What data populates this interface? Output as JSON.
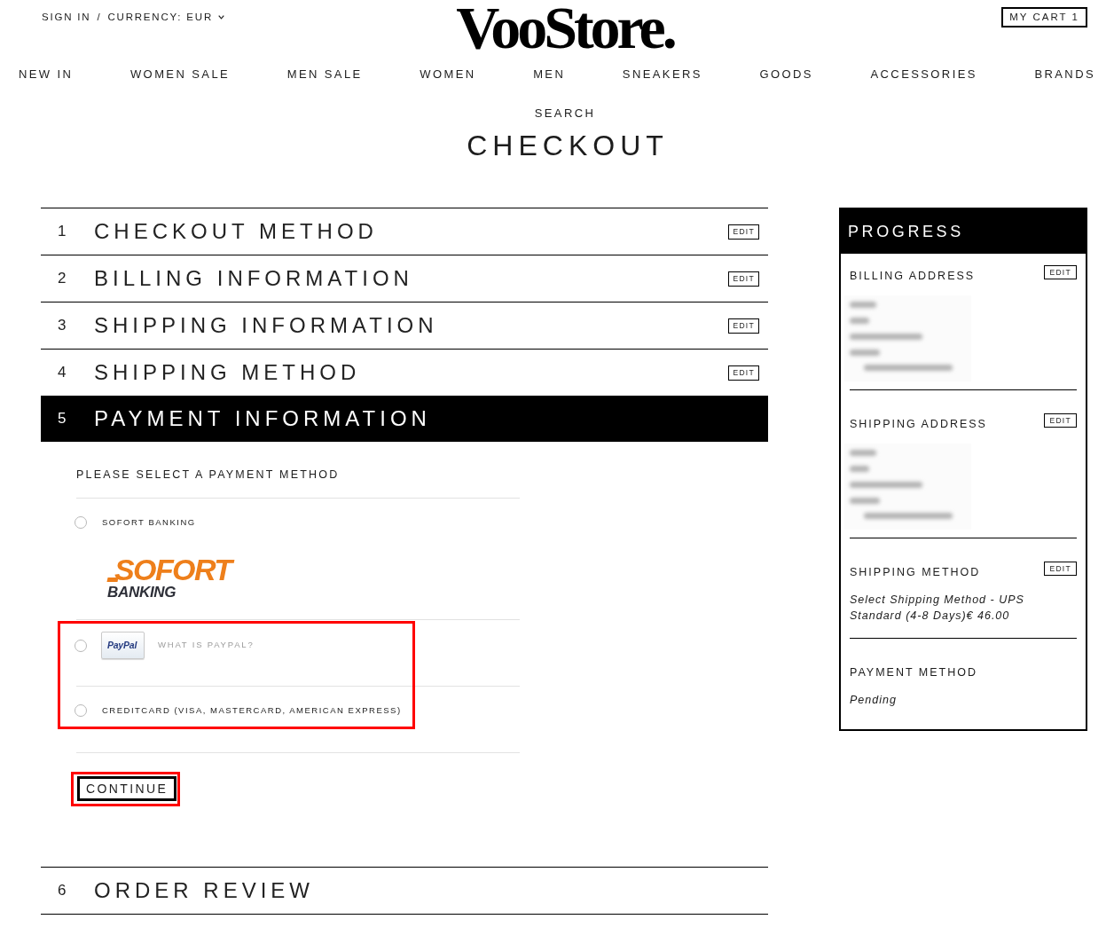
{
  "header": {
    "sign_in": "SIGN IN",
    "separator": "/",
    "currency": "CURRENCY: EUR",
    "logo": "VooStore.",
    "cart": "MY CART 1"
  },
  "nav": [
    "NEW IN",
    "WOMEN SALE",
    "MEN SALE",
    "WOMEN",
    "MEN",
    "SNEAKERS",
    "GOODS",
    "ACCESSORIES",
    "BRANDS"
  ],
  "search": "SEARCH",
  "page_title": "CHECKOUT",
  "steps": [
    {
      "number": "1",
      "title": "CHECKOUT METHOD",
      "edit": "EDIT",
      "active": false
    },
    {
      "number": "2",
      "title": "BILLING INFORMATION",
      "edit": "EDIT",
      "active": false
    },
    {
      "number": "3",
      "title": "SHIPPING INFORMATION",
      "edit": "EDIT",
      "active": false
    },
    {
      "number": "4",
      "title": "SHIPPING METHOD",
      "edit": "EDIT",
      "active": false
    },
    {
      "number": "5",
      "title": "PAYMENT INFORMATION",
      "active": true,
      "panel": {
        "prompt": "PLEASE SELECT A PAYMENT METHOD",
        "options": [
          {
            "kind": "sofort",
            "label": "SOFORT BANKING",
            "logo": [
              "SOFORT",
              "BANKING"
            ],
            "selected": false,
            "highlighted": false
          },
          {
            "kind": "paypal",
            "logo": "PayPal",
            "link": "WHAT IS PAYPAL?",
            "selected": false,
            "highlighted": true
          },
          {
            "kind": "plain",
            "label": "CREDITCARD (VISA, MASTERCARD, AMERICAN EXPRESS)",
            "selected": false,
            "highlighted": true
          }
        ],
        "continue": {
          "label": "CONTINUE",
          "highlighted": true
        }
      }
    },
    {
      "number": "6",
      "title": "ORDER REVIEW",
      "active": false
    }
  ],
  "progress": {
    "title": "PROGRESS",
    "sections": [
      {
        "kind": "address",
        "title": "BILLING ADDRESS",
        "edit": "EDIT"
      },
      {
        "kind": "address",
        "title": "SHIPPING ADDRESS",
        "edit": "EDIT"
      },
      {
        "kind": "text",
        "title": "SHIPPING METHOD",
        "edit": "EDIT",
        "text": "Select Shipping Method - UPS Standard (4-8 Days)€ 46.00"
      },
      {
        "kind": "text",
        "title": "PAYMENT METHOD",
        "text": "Pending"
      }
    ]
  }
}
